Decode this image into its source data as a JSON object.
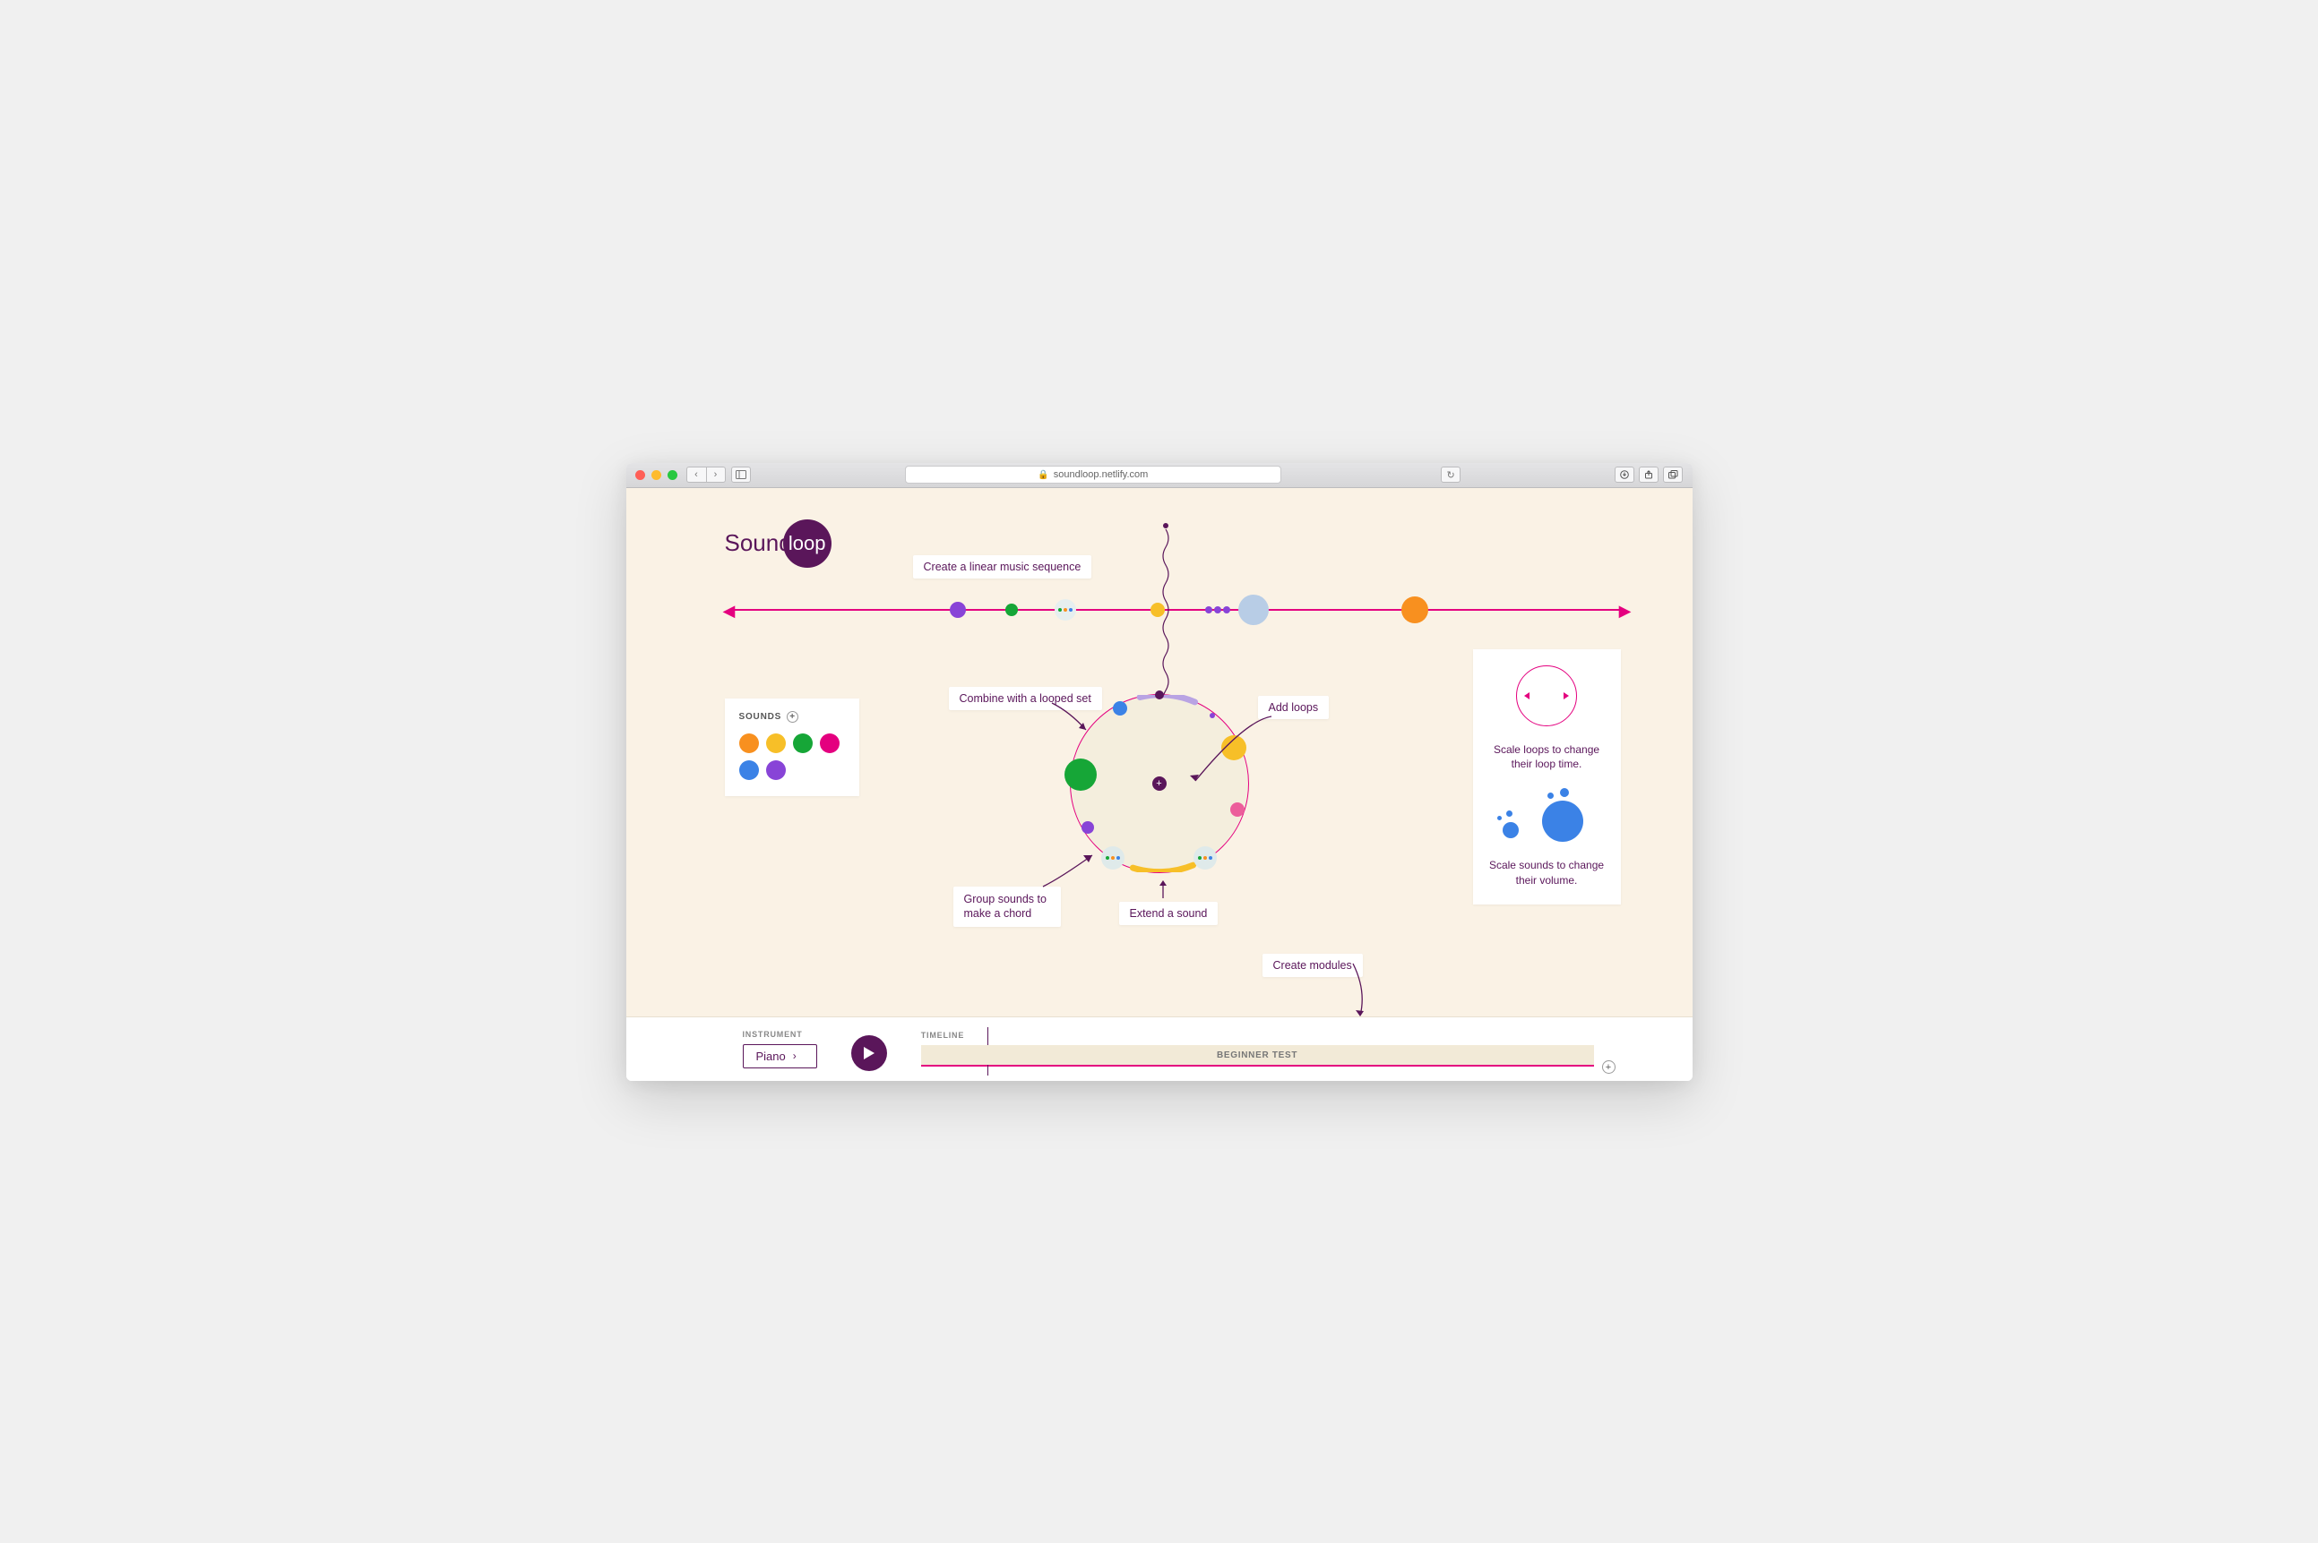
{
  "browser": {
    "url_display": "soundloop.netlify.com",
    "secure": true
  },
  "logo": {
    "part1": "Sound",
    "part2": "loop"
  },
  "callouts": {
    "linear": "Create a linear music sequence",
    "combine": "Combine with a looped set",
    "add_loops": "Add loops",
    "group": "Group sounds to make a chord",
    "extend": "Extend a sound",
    "modules": "Create modules"
  },
  "sounds_panel": {
    "title": "SOUNDS",
    "colors": [
      "#f8901f",
      "#f7bf28",
      "#16a637",
      "#e4007f",
      "#3b82e6",
      "#8844d7"
    ]
  },
  "info_panel": {
    "scale_loops": "Scale loops to change their loop time.",
    "scale_sounds": "Scale sounds to change their volume."
  },
  "footer": {
    "instrument_label": "INSTRUMENT",
    "instrument_value": "Piano",
    "timeline_label": "TIMELINE",
    "module_name": "BEGINNER TEST"
  },
  "colors": {
    "accent": "#5a165a",
    "line": "#e4007f"
  }
}
